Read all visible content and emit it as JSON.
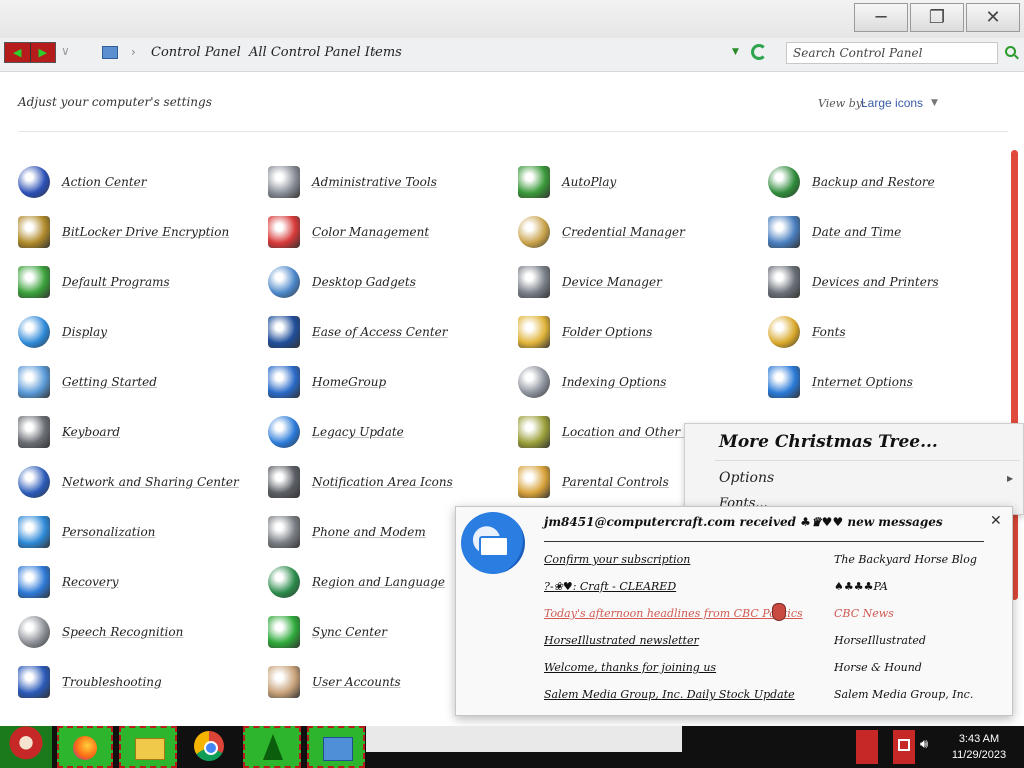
{
  "window": {
    "minimize_icon": "minimize-icon",
    "restore_icon": "restore-icon",
    "close_icon": "close-icon"
  },
  "address": {
    "breadcrumb": [
      "Control Panel",
      "All Control Panel Items"
    ],
    "search_placeholder": "Search Control Panel"
  },
  "header": {
    "adjust_text": "Adjust your computer's settings",
    "view_by_label": "View by:",
    "view_by_value": "Large icons"
  },
  "items": [
    {
      "label": "Action Center",
      "icon": "flag-icon",
      "color": "#2b4fb5"
    },
    {
      "label": "Administrative Tools",
      "icon": "gears-icon",
      "color": "#8a8f99"
    },
    {
      "label": "AutoPlay",
      "icon": "autoplay-icon",
      "color": "#3a9a3a"
    },
    {
      "label": "Backup and Restore",
      "icon": "backup-icon",
      "color": "#2e8b3a"
    },
    {
      "label": "BitLocker Drive Encryption",
      "icon": "key-icon",
      "color": "#b08a2a"
    },
    {
      "label": "Color Management",
      "icon": "color-icon",
      "color": "#d83a3a"
    },
    {
      "label": "Credential Manager",
      "icon": "vault-icon",
      "color": "#c8a24a"
    },
    {
      "label": "Date and Time",
      "icon": "calendar-clock-icon",
      "color": "#4a7fc0"
    },
    {
      "label": "Default Programs",
      "icon": "default-programs-icon",
      "color": "#3aa13a"
    },
    {
      "label": "Desktop Gadgets",
      "icon": "gadgets-icon",
      "color": "#4a86c8"
    },
    {
      "label": "Device Manager",
      "icon": "device-manager-icon",
      "color": "#7a8088"
    },
    {
      "label": "Devices and Printers",
      "icon": "printer-icon",
      "color": "#6a7078"
    },
    {
      "label": "Display",
      "icon": "display-icon",
      "color": "#2e8ad8"
    },
    {
      "label": "Ease of Access Center",
      "icon": "ease-of-access-icon",
      "color": "#1f4e9a"
    },
    {
      "label": "Folder Options",
      "icon": "folder-options-icon",
      "color": "#e0b43a"
    },
    {
      "label": "Fonts",
      "icon": "fonts-icon",
      "color": "#d9a82a"
    },
    {
      "label": "Getting Started",
      "icon": "getting-started-icon",
      "color": "#5a9ad8"
    },
    {
      "label": "HomeGroup",
      "icon": "homegroup-icon",
      "color": "#2a6ac8"
    },
    {
      "label": "Indexing Options",
      "icon": "indexing-icon",
      "color": "#8a8f99"
    },
    {
      "label": "Internet Options",
      "icon": "internet-options-icon",
      "color": "#2a7ad8"
    },
    {
      "label": "Keyboard",
      "icon": "keyboard-icon",
      "color": "#6a6e74"
    },
    {
      "label": "Legacy Update",
      "icon": "legacy-update-icon",
      "color": "#2a7ad8"
    },
    {
      "label": "Location and Other Sensors",
      "icon": "location-icon",
      "color": "#9aa03a"
    },
    {
      "label": "",
      "icon": "hidden-icon",
      "color": "#888888"
    },
    {
      "label": "Network and Sharing Center",
      "icon": "network-icon",
      "color": "#2a5ab8"
    },
    {
      "label": "Notification Area Icons",
      "icon": "notification-area-icon",
      "color": "#5a5e64"
    },
    {
      "label": "Parental Controls",
      "icon": "parental-controls-icon",
      "color": "#d8a23a"
    },
    {
      "label": "",
      "icon": "hidden-icon",
      "color": "#888888"
    },
    {
      "label": "Personalization",
      "icon": "personalization-icon",
      "color": "#2e8ad8"
    },
    {
      "label": "Phone and Modem",
      "icon": "phone-icon",
      "color": "#7a7e84"
    },
    {
      "label": "",
      "icon": "hidden-icon",
      "color": "#888888"
    },
    {
      "label": "",
      "icon": "hidden-icon",
      "color": "#888888"
    },
    {
      "label": "Recovery",
      "icon": "recovery-icon",
      "color": "#2e7ad8"
    },
    {
      "label": "Region and Language",
      "icon": "region-icon",
      "color": "#2a8a4a"
    },
    {
      "label": "",
      "icon": "hidden-icon",
      "color": "#888888"
    },
    {
      "label": "",
      "icon": "hidden-icon",
      "color": "#888888"
    },
    {
      "label": "Speech Recognition",
      "icon": "microphone-icon",
      "color": "#8a8e94"
    },
    {
      "label": "Sync Center",
      "icon": "sync-icon",
      "color": "#2eaa3a"
    },
    {
      "label": "",
      "icon": "hidden-icon",
      "color": "#888888"
    },
    {
      "label": "",
      "icon": "hidden-icon",
      "color": "#888888"
    },
    {
      "label": "Troubleshooting",
      "icon": "troubleshooting-icon",
      "color": "#2a5ab8"
    },
    {
      "label": "User Accounts",
      "icon": "user-accounts-icon",
      "color": "#c8a27a"
    },
    {
      "label": "",
      "icon": "hidden-icon",
      "color": "#888888"
    },
    {
      "label": "",
      "icon": "hidden-icon",
      "color": "#888888"
    }
  ],
  "context_menu": {
    "title": "More Christmas Tree...",
    "option": "Options",
    "partial": "Fonts..."
  },
  "notification": {
    "header": "jm8451@computercraft.com received ♣♛♥♥ new messages",
    "messages": [
      {
        "subject": "Confirm your subscription",
        "from": "The Backyard Horse Blog",
        "highlight": false
      },
      {
        "subject": "?-❀♥: Craft - CLEARED",
        "from": "♠♣♣♣PA",
        "highlight": false
      },
      {
        "subject": "Today's afternoon headlines from CBC Politics",
        "from": "CBC News",
        "highlight": true
      },
      {
        "subject": "HorseIllustrated newsletter",
        "from": "HorseIllustrated",
        "highlight": false
      },
      {
        "subject": "Welcome, thanks for joining us",
        "from": "Horse & Hound",
        "highlight": false
      },
      {
        "subject": "Salem Media Group, Inc. Daily Stock Update",
        "from": "Salem Media Group, Inc.",
        "highlight": false
      }
    ]
  },
  "taskbar": {
    "apps": [
      "start-orb",
      "firefox",
      "file-explorer",
      "chrome",
      "christmas-tree",
      "control-panel"
    ],
    "time": "3:43 AM",
    "date": "11/29/2023"
  }
}
